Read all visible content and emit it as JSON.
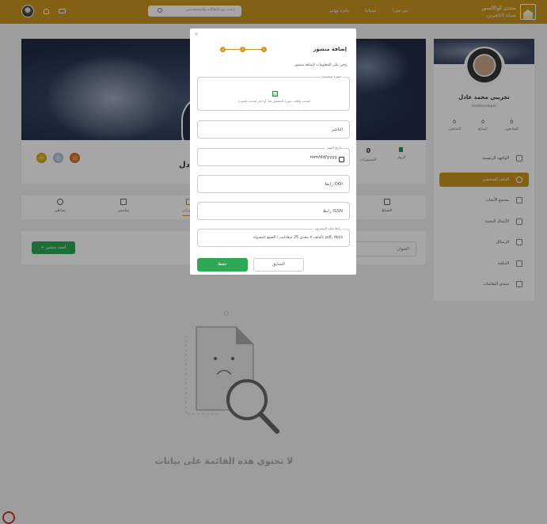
{
  "header": {
    "brand_line1": "منتدى كوالالمبور",
    "brand_line2": "شبكة الناشرين",
    "nav": [
      "جائزة مهاتير",
      "خدماتنا",
      "من نحن؟"
    ],
    "search_placeholder": "إبحث بين المقالات والمستخدمين"
  },
  "profile": {
    "name": "تجريبي محمد عادل",
    "name_peek": "عادل",
    "username": "testdeveloper",
    "stats": [
      {
        "value": "0",
        "label": "المتابعون"
      },
      {
        "value": "0",
        "label": "المتابَع"
      },
      {
        "value": "0",
        "label": "المتابعين"
      }
    ],
    "card_stats": [
      {
        "value": "",
        "label": "الزوار"
      },
      {
        "value": "0",
        "label": "المنشورات"
      }
    ],
    "badge_colors": [
      "#c9961f",
      "#8fa3bf",
      "#c0392b"
    ]
  },
  "tabs": [
    "نشاطي",
    "مناصبي",
    "منشوراتي",
    "",
    "",
    "",
    "",
    "النشاط"
  ],
  "filter": {
    "add_button": "+ أضف منشور",
    "title_placeholder": "العنوان"
  },
  "sidebar_menu": [
    {
      "label": "الواجهة الرئيسية",
      "icon": "home-icon",
      "active": false
    },
    {
      "label": "الملف الشخصي",
      "icon": "user-icon",
      "active": true
    },
    {
      "label": "مجتمع الأبحاث",
      "icon": "research-icon",
      "active": false
    },
    {
      "label": "الأعمال البحثية",
      "icon": "works-icon",
      "active": false
    },
    {
      "label": "الرسائل",
      "icon": "messages-icon",
      "active": false
    },
    {
      "label": "المكتبة",
      "icon": "library-icon",
      "active": false
    },
    {
      "label": "منتدى النقاشات",
      "icon": "forum-icon",
      "active": false
    }
  ],
  "empty_state": {
    "title": "لا تحتوي هذه القائمة على بيانات"
  },
  "modal": {
    "close": "×",
    "title": "إضافة منشور",
    "subtitle": "وحي على المعلومات لإضافة منشور",
    "steps": [
      "1",
      "2",
      "3"
    ],
    "upload_label": "صورة توضيحية",
    "upload_hint": "اسحب وأفلت صورة المنشور هنا، أو انقر لتحديد الصورة",
    "publisher_placeholder": "الناشر",
    "date_label": "تاريخ النشر",
    "date_placeholder": "mm/dd/yyyy",
    "doi_placeholder": "رابط DOI",
    "issn_placeholder": "رابط ISSN",
    "file_label": "رابط ملف المشروع",
    "file_hint": "الملف لا يتعدى 25 ميغابايت / الصيغ المقبولة: pdf, docs",
    "save": "حفظ",
    "previous": "السابق"
  },
  "colors": {
    "accent": "#c9961f",
    "success": "#2ea855"
  }
}
